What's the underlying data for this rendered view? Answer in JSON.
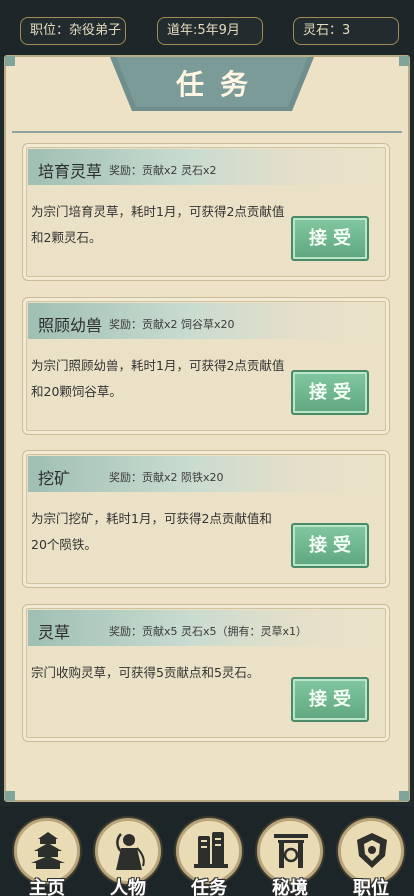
{
  "status_bar": {
    "position": "职位：杂役弟子",
    "year": "道年:5年9月",
    "spirit_stone": "灵石：3"
  },
  "panel": {
    "title": "任务"
  },
  "tasks": [
    {
      "name": "培育灵草",
      "reward": "奖励：贡献x2 灵石x2",
      "desc": "为宗门培育灵草，耗时1月，可获得2点贡献值和2颗灵石。",
      "action": "接受"
    },
    {
      "name": "照顾幼兽",
      "reward": "奖励：贡献x2 饲谷草x20",
      "desc": "为宗门照顾幼兽，耗时1月，可获得2点贡献值和20颗饲谷草。",
      "action": "接受"
    },
    {
      "name": "挖矿",
      "reward": "奖励：贡献x2 陨铁x20",
      "desc": "为宗门挖矿，耗时1月，可获得2点贡献值和20个陨铁。",
      "action": "接受"
    },
    {
      "name": "灵草",
      "reward": "奖励：贡献x5 灵石x5（拥有：灵草x1）",
      "desc": "宗门收购灵草，可获得5贡献点和5灵石。",
      "action": "接受"
    }
  ],
  "nav": [
    {
      "label": "主页",
      "icon": "pagoda-icon"
    },
    {
      "label": "人物",
      "icon": "character-icon"
    },
    {
      "label": "任务",
      "icon": "scroll-icon"
    },
    {
      "label": "秘境",
      "icon": "gate-icon"
    },
    {
      "label": "职位",
      "icon": "emblem-icon"
    }
  ],
  "colors": {
    "background": "#1f2a2c",
    "paper": "#ede2c6",
    "accent_teal": "#7fa59a",
    "button_green": "#6fb68d",
    "gold_border": "#a08c55"
  }
}
